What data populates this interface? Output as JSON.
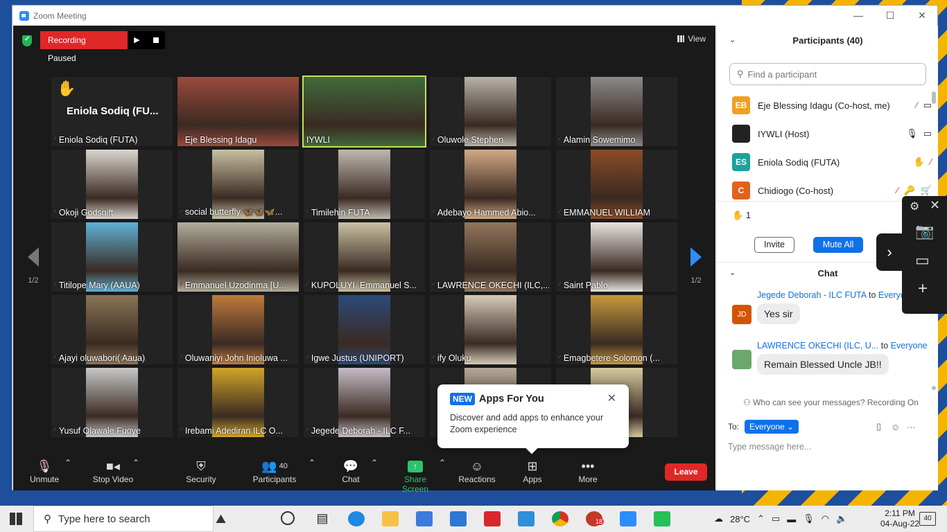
{
  "window": {
    "title": "Zoom Meeting"
  },
  "recording": {
    "label": "Recording Paused"
  },
  "view_label": "View",
  "page_indicator": "1/2",
  "tiles": [
    {
      "name": "Eniola Sodiq (FUTA)",
      "big": "Eniola Sodiq  (FU...",
      "hand": true,
      "color": "#232323",
      "wide": false,
      "video": false
    },
    {
      "name": "Eje Blessing Idagu",
      "color": "#9b4a3c",
      "wide": true,
      "video": true
    },
    {
      "name": "IYWLI",
      "color": "#3f6b3a",
      "wide": true,
      "video": true,
      "active": true
    },
    {
      "name": "Oluwole Stephen",
      "color": "#b8b2a8",
      "video": true
    },
    {
      "name": "Alamin Sowemimo",
      "color": "#8c8a8a",
      "video": true
    },
    {
      "name": "Okoji Godsgift",
      "color": "#d9d6cf",
      "video": true
    },
    {
      "name": "social butterfly 🦋🦋🦋...",
      "color": "#c7c0a2",
      "video": true
    },
    {
      "name": "Timilehin FUTA",
      "color": "#bfb9b0",
      "video": true
    },
    {
      "name": "Adebayo Hammed Abio...",
      "color": "#d2aa84",
      "video": true
    },
    {
      "name": "EMMANUEL WILLIAM",
      "color": "#8a4b24",
      "video": true
    },
    {
      "name": "Titilope Mary (AAUA)",
      "color": "#5fb2d6",
      "video": true
    },
    {
      "name": "Emmanuel Uzodinma [U...",
      "color": "#b2ad9a",
      "wide": true,
      "video": true
    },
    {
      "name": "KUPOLUYI, Emmanuel S...",
      "color": "#c9c1a3",
      "video": true
    },
    {
      "name": "LAWRENCE OKECHI (ILC,...",
      "color": "#93765c",
      "video": true
    },
    {
      "name": "Saint Pablo",
      "color": "#e6e3e0",
      "video": true
    },
    {
      "name": "Ajayi oluwabori( Aaua)",
      "color": "#8a7456",
      "video": true
    },
    {
      "name": "Oluwaniyi John Inioluwa ...",
      "color": "#c07a3c",
      "video": true
    },
    {
      "name": "Igwe Justus (UNIPORT)",
      "color": "#2c4a7a",
      "video": true
    },
    {
      "name": "ify Oluku",
      "color": "#d6cbb8",
      "video": true
    },
    {
      "name": "Emagbetere Solomon (...",
      "color": "#c79a3c",
      "video": true
    },
    {
      "name": "Yusuf Olawale Fuoye",
      "color": "#c8c8c8",
      "video": true
    },
    {
      "name": "Irebami Adediran ILC O...",
      "color": "#d0a628",
      "video": true
    },
    {
      "name": "Jegede Deborah - ILC F...",
      "color": "#c6bcc8",
      "video": true
    },
    {
      "name": "",
      "color": "#b5a99a",
      "video": true
    },
    {
      "name": "jun - Unilag",
      "color": "#d6c9a0",
      "video": true
    }
  ],
  "toolbar": {
    "unmute": "Unmute",
    "stop_video": "Stop Video",
    "security": "Security",
    "participants": "Participants",
    "participants_count": "40",
    "chat": "Chat",
    "share_screen": "Share Screen",
    "reactions": "Reactions",
    "apps": "Apps",
    "more": "More",
    "leave": "Leave"
  },
  "popup": {
    "badge": "NEW",
    "title": "Apps For You",
    "body": "Discover and add apps to enhance your Zoom experience"
  },
  "participants_panel": {
    "title": "Participants (40)",
    "search_placeholder": "Find a participant",
    "list": [
      {
        "initials": "EB",
        "name": "Eje Blessing Idagu (Co-host, me)",
        "color": "#f0a020"
      },
      {
        "initials": "",
        "name": "IYWLI (Host)",
        "color": "#222222"
      },
      {
        "initials": "ES",
        "name": "Eniola Sodiq (FUTA)",
        "color": "#1aa39a"
      },
      {
        "initials": "C",
        "name": "Chidiogo (Co-host)",
        "color": "#e0621e"
      }
    ],
    "raised_hands": "1",
    "invite": "Invite",
    "mute_all": "Mute All"
  },
  "chat_panel": {
    "title": "Chat",
    "messages": [
      {
        "sender": "Jegede Deborah - ILC FUTA",
        "to": "to",
        "recipient": "Everyone",
        "initials": "JD",
        "color": "#d35400",
        "text": "Yes sir"
      },
      {
        "sender": "LAWRENCE OKECHI (ILC, U...",
        "to": "to",
        "recipient": "Everyone",
        "initials": "",
        "color": "#6ca86c",
        "text": "Remain Blessed Uncle JB!!"
      }
    ],
    "who_can_see": "Who can see your messages? Recording On",
    "to_label": "To:",
    "to_value": "Everyone",
    "placeholder": "Type message here..."
  },
  "taskbar": {
    "search_placeholder": "Type here to search",
    "temperature": "28°C",
    "time": "2:11 PM",
    "date": "04-Aug-22",
    "badge": "18",
    "notifications": "40"
  }
}
